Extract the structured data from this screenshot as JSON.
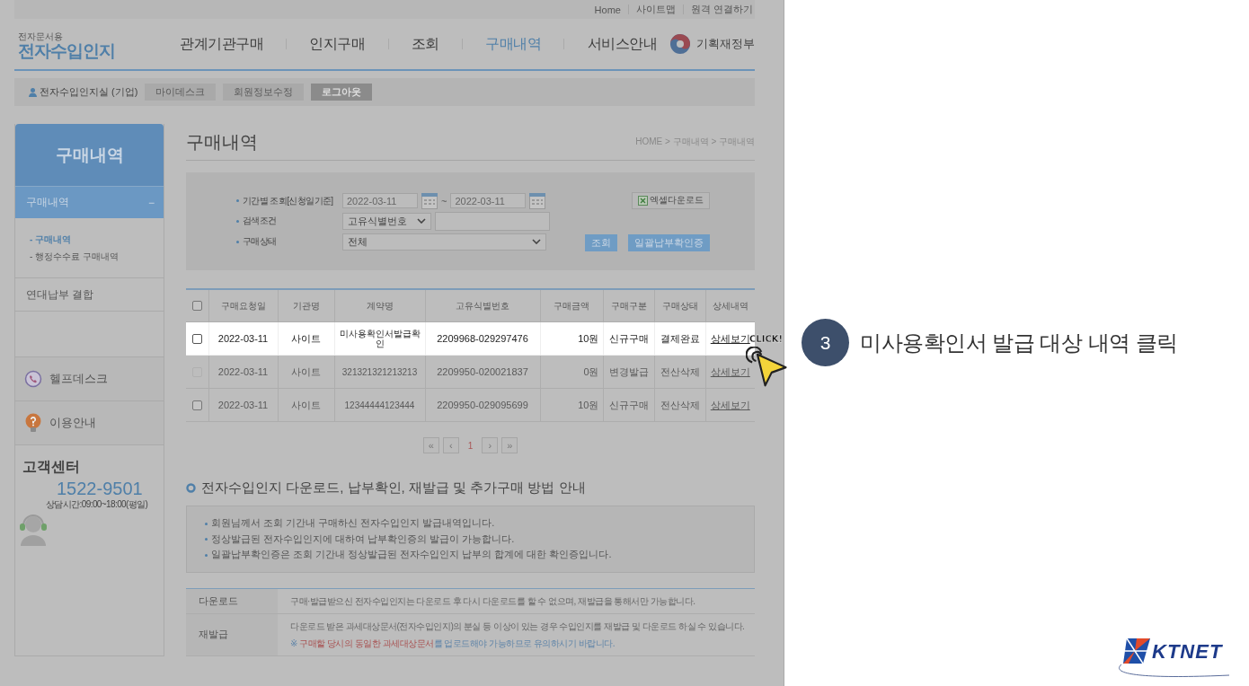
{
  "util_links": [
    "Home",
    "사이트맵",
    "원격 연결하기"
  ],
  "logo": {
    "small": "전자문서용",
    "main": "전자수입인지"
  },
  "nav": [
    {
      "label": "관계기관구매",
      "selected": false
    },
    {
      "label": "인지구매",
      "selected": false
    },
    {
      "label": "조회",
      "selected": false
    },
    {
      "label": "구매내역",
      "selected": true
    },
    {
      "label": "서비스안내",
      "selected": false
    }
  ],
  "ministry": "기획재정부",
  "user_bar": {
    "user": "전자수입인지실 (기업)",
    "buttons": [
      {
        "label": "마이데스크",
        "kind": "light"
      },
      {
        "label": "회원정보수정",
        "kind": "light"
      },
      {
        "label": "로그아웃",
        "kind": "dark"
      }
    ]
  },
  "sidebar": {
    "title": "구매내역",
    "menu": {
      "label": "구매내역",
      "toggle": "−",
      "expanded": true,
      "children": [
        {
          "label": "- 구매내역",
          "selected": true
        },
        {
          "label": "- 행정수수료 구매내역",
          "selected": false
        }
      ]
    },
    "items": [
      "연대납부 결합"
    ],
    "links": [
      {
        "label": "헬프데스크",
        "kind": "phone"
      },
      {
        "label": "이용안내",
        "kind": "help"
      }
    ],
    "center": {
      "title": "고객센터",
      "phone": "1522-9501",
      "hours": "상담시간:09:00~18:00(평일)"
    }
  },
  "page": {
    "title": "구매내역",
    "breadcrumb": "HOME > 구매내역 > 구매내역"
  },
  "search": {
    "period": {
      "label": "기간별 조회[신청일기준]",
      "from": "2022-03-11",
      "separator": "~",
      "to": "2022-03-11"
    },
    "condition": {
      "label": "검색조건",
      "select": "고유식별번호"
    },
    "status": {
      "label": "구매상태",
      "select": "전체"
    },
    "excel_button": "엑셀다운로드",
    "search_button": "조회",
    "batch_button": "일괄납부확인증"
  },
  "table": {
    "select_all_checked": false,
    "columns": [
      "구매요청일",
      "기관명",
      "계약명",
      "고유식별번호",
      "구매금액",
      "구매구분",
      "구매상태",
      "상세내역"
    ],
    "rows": [
      {
        "highlighted": true,
        "checked": false,
        "disabled": false,
        "cells": [
          "2022-03-11",
          "사이트",
          "미사용확인서발급확인",
          "2209968-029297476",
          "10원",
          "신규구매",
          "결제완료"
        ],
        "detail": "상세보기"
      },
      {
        "highlighted": false,
        "checked": false,
        "disabled": true,
        "cells": [
          "2022-03-11",
          "사이트",
          "321321321213213",
          "2209950-020021837",
          "0원",
          "변경발급",
          "전산삭제"
        ],
        "detail": "상세보기"
      },
      {
        "highlighted": false,
        "checked": false,
        "disabled": false,
        "cells": [
          "2022-03-11",
          "사이트",
          "12344444123444",
          "2209950-029095699",
          "10원",
          "신규구매",
          "전산삭제"
        ],
        "detail": "상세보기"
      }
    ]
  },
  "pagination": [
    {
      "label": "«",
      "selected": false
    },
    {
      "label": "‹",
      "selected": false
    },
    {
      "label": "1",
      "selected": true
    },
    {
      "label": "›",
      "selected": false
    },
    {
      "label": "»",
      "selected": false
    }
  ],
  "guide": {
    "title": "전자수입인지 다운로드, 납부확인, 재발급 및 추가구매 방법 안내",
    "notices": [
      "회원님께서 조회 기간내 구매하신 전자수입인지 발급내역입니다.",
      "정상발급된 전자수입인지에 대하여 납부확인증의 발급이 가능합니다.",
      "일괄납부확인증은 조회 기간내 정상발급된 전자수입인지 납부의 합계에 대한 확인증입니다."
    ],
    "rows": [
      {
        "label": "다운로드",
        "text": "구매·발급받으신 전자수입인지는 다운로드 후 다시 다운로드를 할 수 없으며, 재발급을 통해서만 가능합니다."
      },
      {
        "label": "재발급",
        "text": "다운로드 받은 과세대상문서(전자수입인지)의 분실 등 이상이 있는 경우 수입인지를 재발급 및 다운로드 하실 수 있습니다.",
        "note": "※ **구매할 당시의 동일한 과세대상문서**를 업로드해야 가능하므로 유의하시기 바랍니다."
      }
    ]
  },
  "cursor_label": "CLICK!",
  "callout": {
    "step": "3",
    "text": "미사용확인서 발급 대상 내역 클릭"
  },
  "brand": "KTNET"
}
